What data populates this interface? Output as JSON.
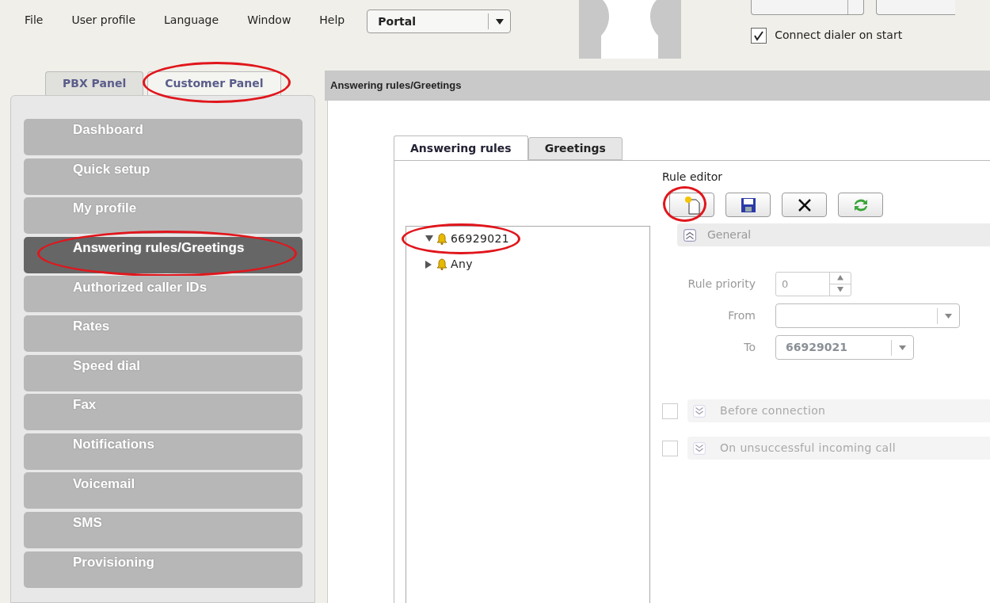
{
  "menu_bar": {
    "items": [
      "File",
      "User profile",
      "Language",
      "Window",
      "Help"
    ],
    "portal_select": {
      "value": "Portal"
    }
  },
  "dialer": {
    "connect_on_start": {
      "label": "Connect dialer on start",
      "checked": true
    }
  },
  "panel_tabs": [
    {
      "label": "PBX Panel",
      "selected": false,
      "circled": false
    },
    {
      "label": "Customer Panel",
      "selected": true,
      "circled": true
    }
  ],
  "sidebar": {
    "items": [
      {
        "label": "Dashboard",
        "selected": false,
        "circled": false
      },
      {
        "label": "Quick setup",
        "selected": false,
        "circled": false
      },
      {
        "label": "My profile",
        "selected": false,
        "circled": false
      },
      {
        "label": "Answering rules/Greetings",
        "selected": true,
        "circled": true
      },
      {
        "label": "Authorized caller IDs",
        "selected": false,
        "circled": false
      },
      {
        "label": "Rates",
        "selected": false,
        "circled": false
      },
      {
        "label": "Speed dial",
        "selected": false,
        "circled": false
      },
      {
        "label": "Fax",
        "selected": false,
        "circled": false
      },
      {
        "label": "Notifications",
        "selected": false,
        "circled": false
      },
      {
        "label": "Voicemail",
        "selected": false,
        "circled": false
      },
      {
        "label": "SMS",
        "selected": false,
        "circled": false
      },
      {
        "label": "Provisioning",
        "selected": false,
        "circled": false
      }
    ]
  },
  "content": {
    "title": "Answering rules/Greetings",
    "tabs": [
      {
        "label": "Answering rules",
        "selected": true
      },
      {
        "label": "Greetings",
        "selected": false
      }
    ],
    "tree": [
      {
        "label": "66929021",
        "expanded": true,
        "circled": true
      },
      {
        "label": "Any",
        "expanded": false,
        "circled": false
      }
    ],
    "rule_editor": {
      "title": "Rule editor",
      "toolbar": [
        {
          "kind": "new",
          "circled": true
        },
        {
          "kind": "save",
          "circled": false
        },
        {
          "kind": "delete",
          "circled": false
        },
        {
          "kind": "refresh",
          "circled": false
        }
      ],
      "general_section": {
        "title": "General",
        "expanded": true
      },
      "fields": [
        {
          "kind": "spinner",
          "label": "Rule priority",
          "value": "0"
        },
        {
          "kind": "select",
          "label": "From"
        },
        {
          "kind": "select",
          "label": "To",
          "value": "66929021"
        }
      ],
      "sections": [
        {
          "title": "Before connection",
          "checked": false,
          "expanded": false
        },
        {
          "title": "On unsuccessful incoming call",
          "checked": false,
          "expanded": false
        }
      ]
    }
  }
}
